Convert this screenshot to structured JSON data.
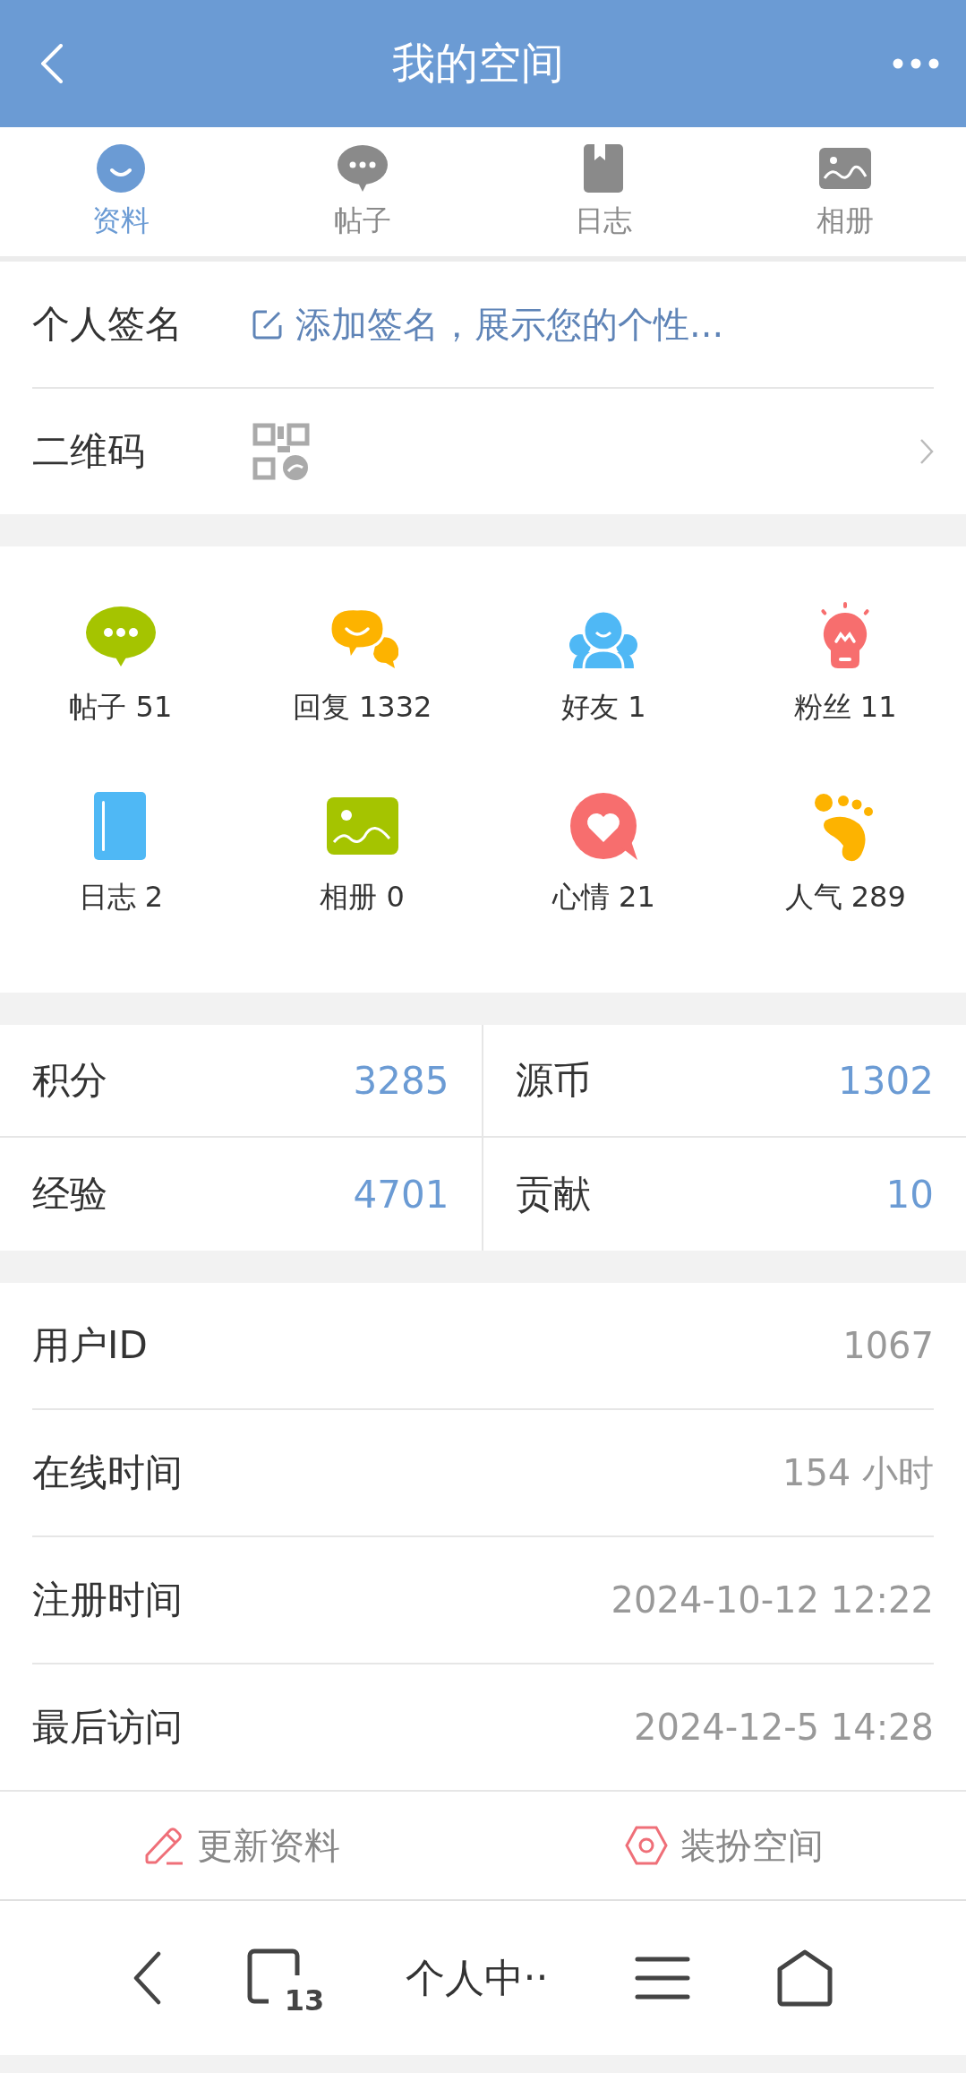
{
  "header": {
    "title": "我的空间"
  },
  "tabs": [
    {
      "label": "资料",
      "selected": true
    },
    {
      "label": "帖子",
      "selected": false
    },
    {
      "label": "日志",
      "selected": false
    },
    {
      "label": "相册",
      "selected": false
    }
  ],
  "signature": {
    "label": "个人签名",
    "value": "添加签名，展示您的个性..."
  },
  "qrcode": {
    "label": "二维码"
  },
  "counters": [
    {
      "label": "帖子 51"
    },
    {
      "label": "回复 1332"
    },
    {
      "label": "好友 1"
    },
    {
      "label": "粉丝 11"
    },
    {
      "label": "日志 2"
    },
    {
      "label": "相册 0"
    },
    {
      "label": "心情 21"
    },
    {
      "label": "人气 289"
    }
  ],
  "stats": [
    {
      "label": "积分",
      "value": "3285"
    },
    {
      "label": "源币",
      "value": "1302"
    },
    {
      "label": "经验",
      "value": "4701"
    },
    {
      "label": "贡献",
      "value": "10"
    }
  ],
  "info": [
    {
      "label": "用户ID",
      "value": "1067"
    },
    {
      "label": "在线时间",
      "value": "154 小时"
    },
    {
      "label": "注册时间",
      "value": "2024-10-12 12:22"
    },
    {
      "label": "最后访问",
      "value": "2024-12-5 14:28"
    }
  ],
  "actions": [
    {
      "label": "更新资料"
    },
    {
      "label": "装扮空间"
    }
  ],
  "browser_bar": {
    "tab_count": "13",
    "title": "个人中··"
  }
}
